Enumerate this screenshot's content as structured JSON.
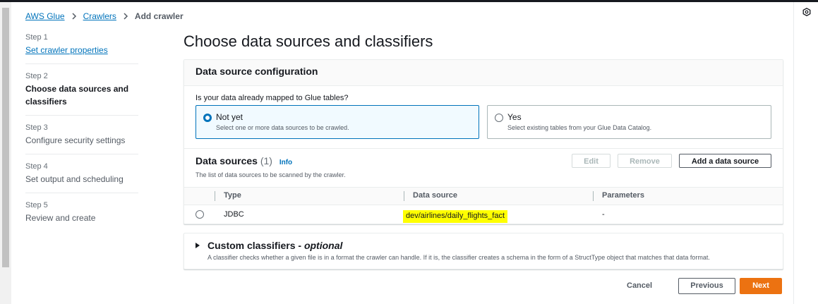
{
  "breadcrumb": {
    "items": [
      "AWS Glue",
      "Crawlers"
    ],
    "current": "Add crawler"
  },
  "steps": [
    {
      "num": "Step 1",
      "title": "Set crawler properties"
    },
    {
      "num": "Step 2",
      "title": "Choose data sources and classifiers"
    },
    {
      "num": "Step 3",
      "title": "Configure security settings"
    },
    {
      "num": "Step 4",
      "title": "Set output and scheduling"
    },
    {
      "num": "Step 5",
      "title": "Review and create"
    }
  ],
  "page_title": "Choose data sources and classifiers",
  "config": {
    "title": "Data source configuration",
    "question": "Is your data already mapped to Glue tables?",
    "options": [
      {
        "title": "Not yet",
        "desc": "Select one or more data sources to be crawled.",
        "selected": true
      },
      {
        "title": "Yes",
        "desc": "Select existing tables from your Glue Data Catalog.",
        "selected": false
      }
    ]
  },
  "data_sources": {
    "title": "Data sources",
    "count": "(1)",
    "info": "Info",
    "desc": "The list of data sources to be scanned by the crawler.",
    "buttons": {
      "edit": "Edit",
      "remove": "Remove",
      "add": "Add a data source"
    },
    "columns": [
      "Type",
      "Data source",
      "Parameters"
    ],
    "rows": [
      {
        "type": "JDBC",
        "source": "dev/airlines/daily_flights_fact",
        "params": "-"
      }
    ]
  },
  "classifiers": {
    "title": "Custom classifiers - ",
    "optional": "optional",
    "desc": "A classifier checks whether a given file is in a format the crawler can handle. If it is, the classifier creates a schema in the form of a StructType object that matches that data format."
  },
  "footer": {
    "cancel": "Cancel",
    "previous": "Previous",
    "next": "Next"
  },
  "colors": {
    "accent": "#0073bb",
    "primary_button": "#ec7211",
    "highlight": "#ffff00"
  }
}
